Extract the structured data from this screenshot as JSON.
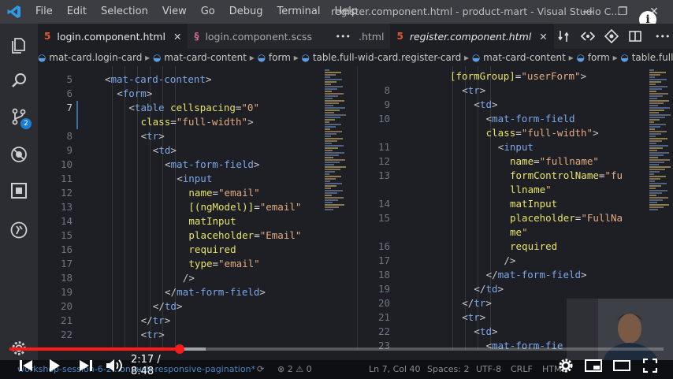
{
  "titlebar": {
    "menu": [
      "File",
      "Edit",
      "Selection",
      "View",
      "Go",
      "Debug",
      "Terminal",
      "Help"
    ],
    "title": "register.component.html - product-mart - Visual Studio C...",
    "minimize": "—",
    "maximize": "❐",
    "close": "✕"
  },
  "activity": {
    "scm_badge": "2"
  },
  "tabs_left": [
    {
      "icon": "5",
      "label": "login.component.html",
      "close": "✕"
    },
    {
      "icon": "§",
      "label": "login.component.scss"
    }
  ],
  "tabs_left_more": "•••",
  "tabs_right": [
    {
      "label": ".html"
    },
    {
      "icon": "5",
      "label": "register.component.html",
      "close": "✕"
    }
  ],
  "tabs_right_more": "•••",
  "breadcrumb": [
    "mat-card.login-card",
    "mat-card-content",
    "form",
    "table.full-wid-card.register-card",
    "mat-card-content",
    "form",
    "table.full-width"
  ],
  "editor_left": {
    "lines": [
      {
        "n": "5",
        "code": "<mat-card-content>"
      },
      {
        "n": "6",
        "code": "<form>"
      },
      {
        "n": "7",
        "code": "<table cellspacing=\"0\""
      },
      {
        "n": "",
        "code": "class=\"full-width\">"
      },
      {
        "n": "8",
        "code": "<tr>"
      },
      {
        "n": "9",
        "code": "<td>"
      },
      {
        "n": "10",
        "code": "<mat-form-field>"
      },
      {
        "n": "11",
        "code": "<input"
      },
      {
        "n": "12",
        "code": "name=\"email\""
      },
      {
        "n": "13",
        "code": "[(ngModel)]=\"email\""
      },
      {
        "n": "14",
        "code": "matInput"
      },
      {
        "n": "15",
        "code": "placeholder=\"Email\""
      },
      {
        "n": "16",
        "code": "required"
      },
      {
        "n": "17",
        "code": "type=\"email\""
      },
      {
        "n": "18",
        "code": "/>"
      },
      {
        "n": "19",
        "code": "</mat-form-field>"
      },
      {
        "n": "20",
        "code": "</td>"
      },
      {
        "n": "21",
        "code": "</tr>"
      },
      {
        "n": "22",
        "code": "<tr>"
      }
    ]
  },
  "editor_right": {
    "lines": [
      {
        "n": "",
        "code": "[formGroup]=\"userForm\">"
      },
      {
        "n": "8",
        "code": "<tr>"
      },
      {
        "n": "9",
        "code": "<td>"
      },
      {
        "n": "10",
        "code": "<mat-form-field"
      },
      {
        "n": "",
        "code": "class=\"full-width\">"
      },
      {
        "n": "11",
        "code": "<input"
      },
      {
        "n": "12",
        "code": "name=\"fullname\""
      },
      {
        "n": "13",
        "code": "formControlName=\"fu"
      },
      {
        "n": "",
        "code": "llname\""
      },
      {
        "n": "14",
        "code": "matInput"
      },
      {
        "n": "15",
        "code": "placeholder=\"FullNa"
      },
      {
        "n": "",
        "code": "me\""
      },
      {
        "n": "16",
        "code": "required"
      },
      {
        "n": "17",
        "code": "/>"
      },
      {
        "n": "18",
        "code": "</mat-form-field>"
      },
      {
        "n": "19",
        "code": "</td>"
      },
      {
        "n": "20",
        "code": "</tr>"
      },
      {
        "n": "21",
        "code": "<tr>"
      },
      {
        "n": "22",
        "code": "<td>"
      },
      {
        "n": "23",
        "code": "<mat-form-fie"
      }
    ]
  },
  "statusbar": {
    "branch": "workshop-session-6-2...onpush-responsive-pagination*",
    "sync": "⟳",
    "problems": "⊗ 2 ⚠ 0",
    "position": "Ln 7, Col 40",
    "spaces": "Spaces: 2",
    "encoding": "UTF-8",
    "eol": "CRLF",
    "language": "HTML"
  },
  "player": {
    "time": "2:17 / 8:48",
    "played_fraction": 0.26,
    "loaded_fraction": 0.3
  },
  "info_icon": "i",
  "colors": {
    "accent": "#1a7fd4",
    "progress": "#ff1a1a",
    "tag": "#7aa7e8",
    "attr": "#e7e36b",
    "string": "#e3aa82"
  }
}
